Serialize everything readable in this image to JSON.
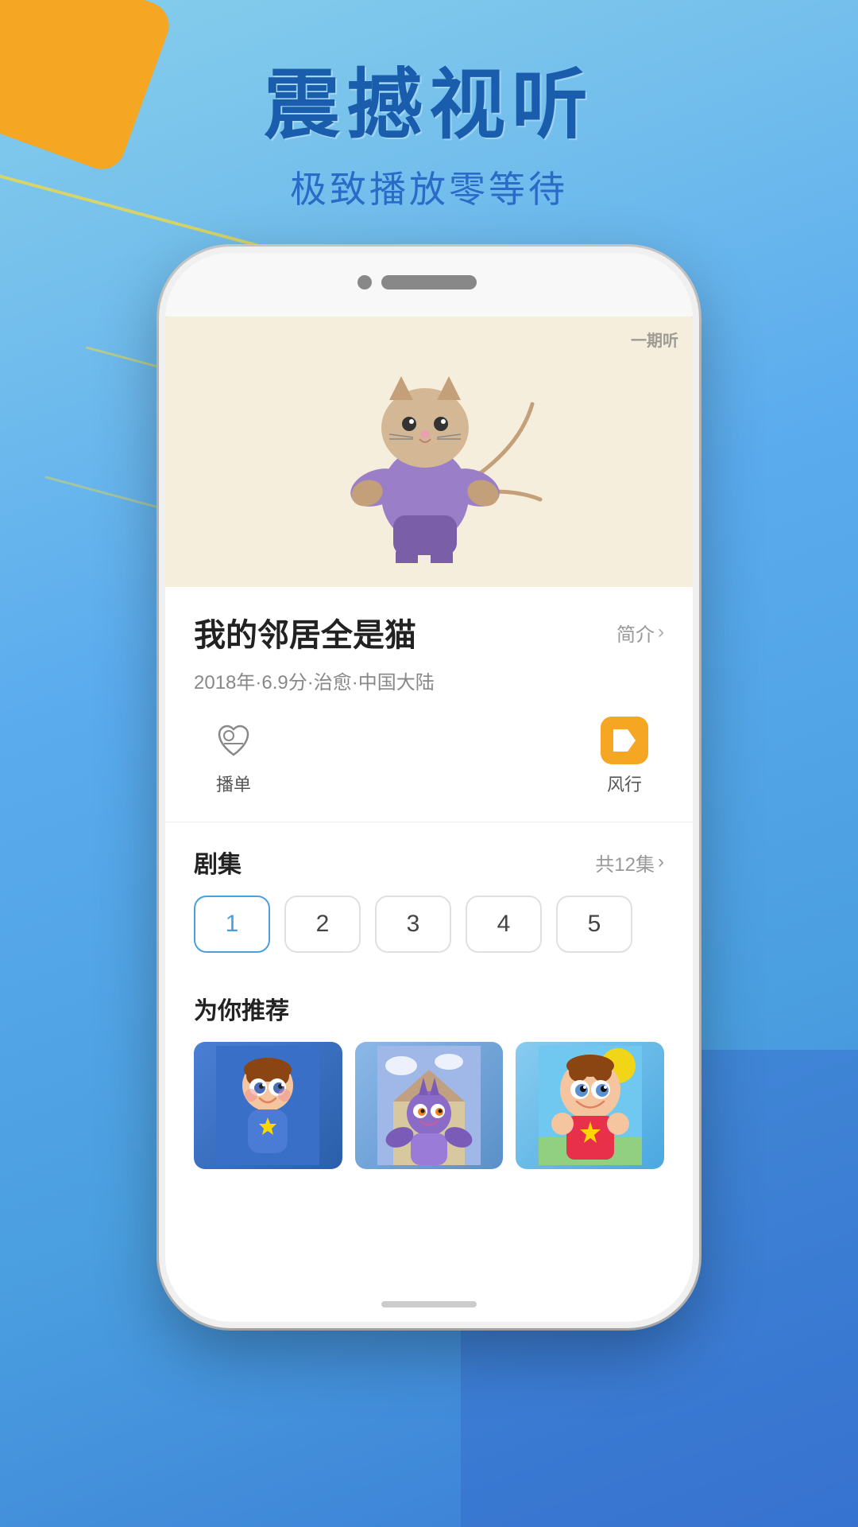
{
  "background": {
    "primaryColor": "#70BFEA",
    "accentColor": "#F5A623",
    "waveColor": "rgba(50,100,200,0.4)"
  },
  "header": {
    "mainTitle": "震撼视听",
    "subTitle": "极致播放零等待"
  },
  "phone": {
    "videoWatermark": "一期听",
    "showTitle": "我的邻居全是猫",
    "introLabel": "简介",
    "metaInfo": "2018年·6.9分·治愈·中国大陆",
    "playlist": {
      "icon": "heart-playlist",
      "label": "播单"
    },
    "fengxing": {
      "label": "风行"
    },
    "episodes": {
      "sectionTitle": "剧集",
      "totalLabel": "共12集",
      "items": [
        "1",
        "2",
        "3",
        "4",
        "5"
      ]
    },
    "recommendations": {
      "sectionTitle": "为你推荐",
      "items": [
        {
          "id": 1,
          "alt": "动画推荐1"
        },
        {
          "id": 2,
          "alt": "动画推荐2"
        },
        {
          "id": 3,
          "alt": "动画推荐3"
        }
      ]
    }
  }
}
